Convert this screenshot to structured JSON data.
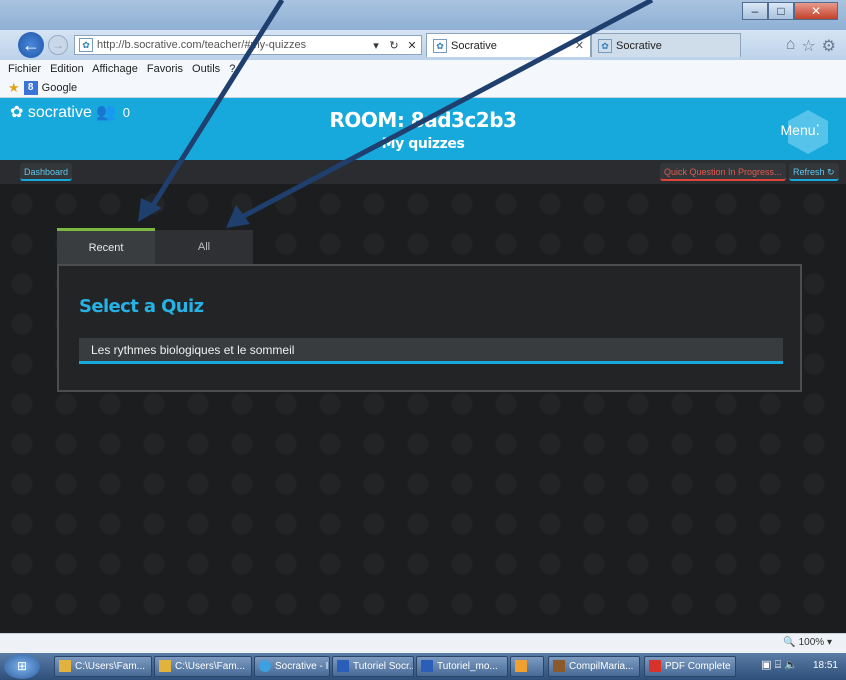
{
  "browser": {
    "address_url": "http://b.socrative.com/teacher/#my-quizzes",
    "tabs": [
      {
        "label": "Socrative"
      },
      {
        "label": "Socrative"
      }
    ],
    "menu": [
      "Fichier",
      "Edition",
      "Affichage",
      "Favoris",
      "Outils",
      "?"
    ],
    "favorites": {
      "google_label": "Google"
    },
    "zoom": "100%"
  },
  "app": {
    "logo_text": "socrative",
    "student_count": "0",
    "room_title": "ROOM: 8ad3c2b3",
    "page_subtitle": "My quizzes",
    "menu_label": "Menu",
    "toolbar": {
      "dashboard_label": "Dashboard",
      "quick_question_label": "Quick Question In Progress...",
      "refresh_label": "Refresh"
    },
    "tabs": [
      {
        "label": "Recent"
      },
      {
        "label": "All"
      }
    ],
    "panel": {
      "title": "Select a Quiz",
      "quizzes": [
        "Les rythmes biologiques et le sommeil"
      ]
    }
  },
  "taskbar": {
    "items": [
      {
        "label": "C:\\Users\\Fam..."
      },
      {
        "label": "C:\\Users\\Fam..."
      },
      {
        "label": "Socrative - In..."
      },
      {
        "label": "Tutoriel Socr..."
      },
      {
        "label": "Tutoriel_mo..."
      },
      {
        "label": "CompilMaria..."
      },
      {
        "label": "PDF Complete"
      }
    ],
    "clock": "18:51"
  },
  "colors": {
    "accent": "#18a9dc",
    "active_tab": "#7ab83e",
    "alert": "#e0443c",
    "arrow": "#1f3f6e"
  }
}
